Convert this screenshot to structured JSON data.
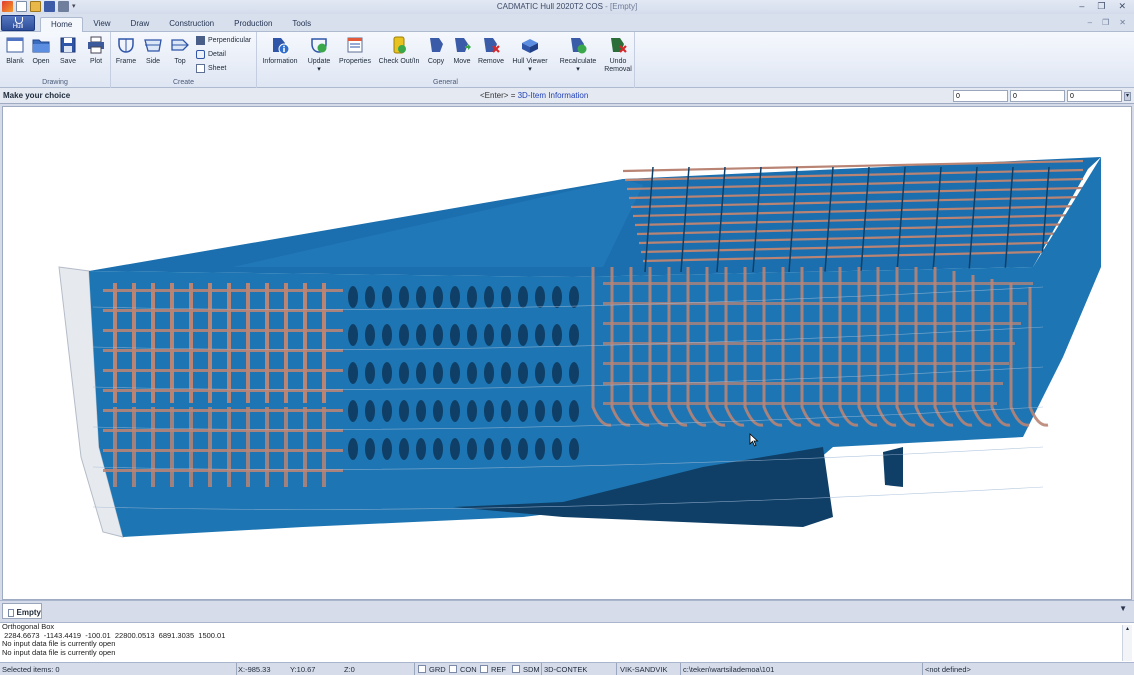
{
  "window": {
    "title": "CADMATIC Hull 2020T2 COS",
    "doc_suffix": " - [Empty]",
    "controls": [
      "minimize",
      "restore",
      "close"
    ]
  },
  "app_button": {
    "label": "Hull"
  },
  "tabs": [
    {
      "label": "Home",
      "active": true
    },
    {
      "label": "View"
    },
    {
      "label": "Draw"
    },
    {
      "label": "Construction"
    },
    {
      "label": "Production"
    },
    {
      "label": "Tools"
    }
  ],
  "ribbon": {
    "drawing": {
      "label": "Drawing",
      "buttons": [
        "Blank",
        "Open",
        "Save",
        "Plot"
      ]
    },
    "create": {
      "label": "Create",
      "buttons": [
        "Frame",
        "Side",
        "Top"
      ],
      "small": [
        "Perpendicular",
        "Detail",
        "Sheet"
      ]
    },
    "general": {
      "label": "General",
      "buttons": [
        "Information",
        "Update",
        "Properties",
        "Check Out/In",
        "Copy",
        "Move",
        "Remove",
        "Hull Viewer",
        "Recalculate",
        "Undo"
      ],
      "undo_line2": "Removal"
    }
  },
  "prompt": {
    "label": "Make your choice",
    "hint_prefix": "<Enter> = ",
    "hint_link": "3D-Item Information",
    "coords": [
      "0",
      "0",
      "0"
    ]
  },
  "document_tab": {
    "label": "Empty"
  },
  "log": [
    "Orthogonal Box",
    " 2284.6673  -1143.4419  -100.01  22800.0513  6891.3035  1500.01",
    "No input data file is currently open",
    "No input data file is currently open"
  ],
  "status": {
    "selected": "Selected items: 0",
    "x": "X:-985.33",
    "y": "Y:10.67",
    "z": "Z:0",
    "toggles": [
      "GRD",
      "CON",
      "REF",
      "SDM"
    ],
    "mode": "3D-CONTEK",
    "project": "VIK-SANDVIK",
    "path": "c:\\teken\\wartsilademoa\\101",
    "not_defined": "<not defined>"
  },
  "colors": {
    "hull_blue": "#1d76b3",
    "plate_dark": "#0f3f66",
    "structure_copper": "#b98474",
    "ribbon_accent": "#2e4e9a"
  }
}
